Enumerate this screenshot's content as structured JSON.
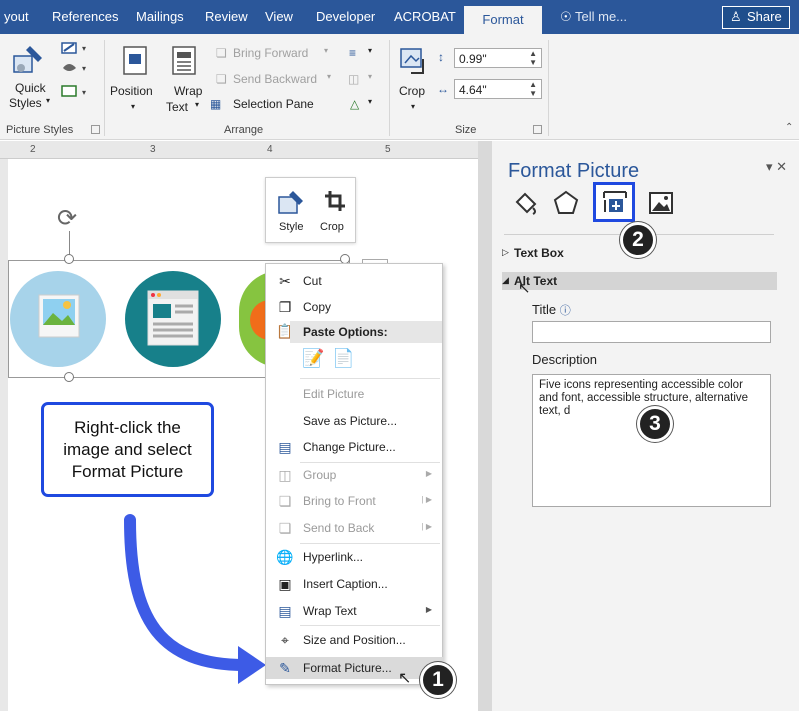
{
  "ribbon_tabs": [
    "yout",
    "References",
    "Mailings",
    "Review",
    "View",
    "Developer",
    "ACROBAT"
  ],
  "active_tab": "Format",
  "tell_me": "Tell me...",
  "share": "Share",
  "ribbon": {
    "quick_styles_1": "Quick",
    "quick_styles_2": "Styles",
    "position": "Position",
    "wrap_text_1": "Wrap",
    "wrap_text_2": "Text",
    "bring_forward": "Bring Forward",
    "send_backward": "Send Backward",
    "selection_pane": "Selection Pane",
    "crop": "Crop",
    "height": "0.99\"",
    "width": "4.64\"",
    "group_picture_styles": "Picture Styles",
    "group_arrange": "Arrange",
    "group_size": "Size"
  },
  "ruler_marks": [
    "2",
    "3",
    "4",
    "5"
  ],
  "minibar": {
    "style": "Style",
    "crop": "Crop"
  },
  "callout": {
    "line1": "Right-click the",
    "line2": "image and select",
    "line3": "Format Picture"
  },
  "context_menu": {
    "cut": "Cut",
    "copy": "Copy",
    "paste_options": "Paste Options:",
    "edit_picture": "Edit Picture",
    "save_as_picture": "Save as Picture...",
    "change_picture": "Change Picture...",
    "group": "Group",
    "bring_to_front": "Bring to Front",
    "send_to_back": "Send to Back",
    "hyperlink": "Hyperlink...",
    "insert_caption": "Insert Caption...",
    "wrap_text": "Wrap Text",
    "size_and_position": "Size and Position...",
    "format_picture": "Format Picture..."
  },
  "pane": {
    "title": "Format Picture",
    "text_box": "Text Box",
    "alt_text": "Alt Text",
    "title_label": "Title",
    "description_label": "Description",
    "description_value": "Five icons representing accessible color and font, accessible structure, alternative text, d"
  },
  "badges": [
    "1",
    "2",
    "3"
  ],
  "colors": {
    "accent": "#2b579a",
    "highlight": "#1f49e0",
    "arrow": "#3d5be6"
  }
}
